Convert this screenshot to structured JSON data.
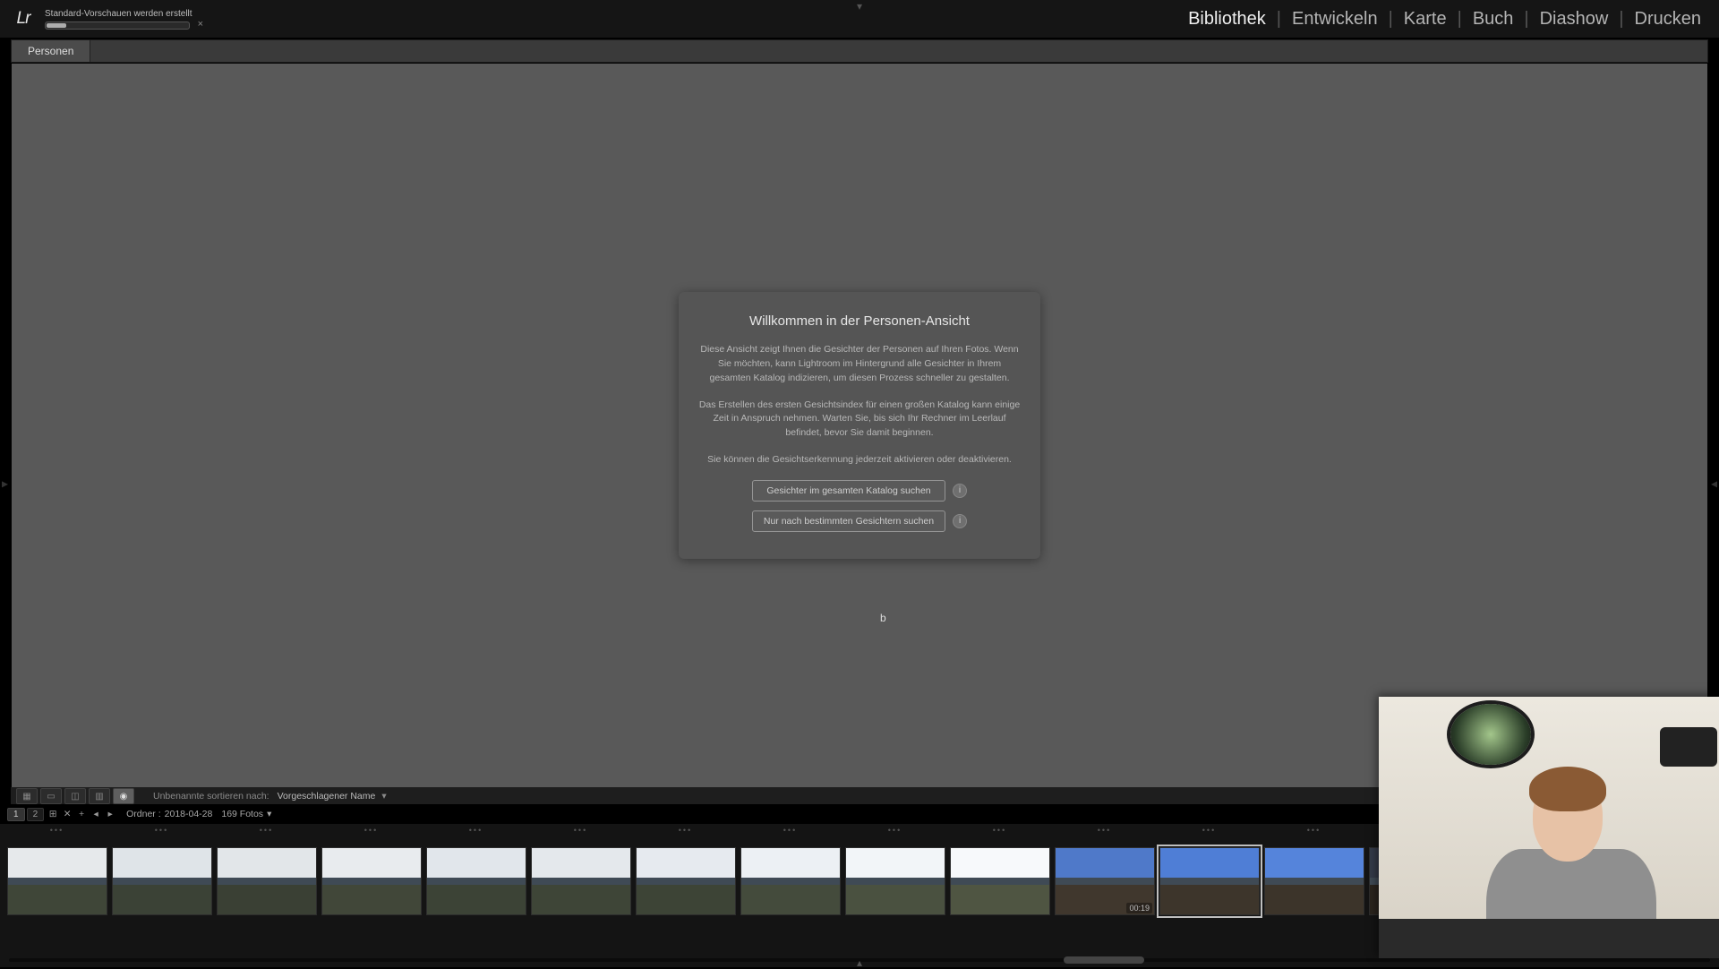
{
  "app": {
    "logo": "Lr"
  },
  "progress": {
    "label": "Standard-Vorschauen werden erstellt",
    "close": "×"
  },
  "modules": {
    "items": [
      "Bibliothek",
      "Entwickeln",
      "Karte",
      "Buch",
      "Diashow",
      "Drucken"
    ],
    "active_index": 0,
    "separator": "|"
  },
  "tabs": {
    "items": [
      "Personen"
    ]
  },
  "dialog": {
    "title": "Willkommen in der Personen-Ansicht",
    "p1": "Diese Ansicht zeigt Ihnen die Gesichter der Personen auf Ihren Fotos. Wenn Sie möchten, kann Lightroom im Hintergrund alle Gesichter in Ihrem gesamten Katalog indizieren, um diesen Prozess schneller zu gestalten.",
    "p2": "Das Erstellen des ersten Gesichtsindex für einen großen Katalog kann einige Zeit in Anspruch nehmen. Warten Sie, bis sich Ihr Rechner im Leerlauf befindet, bevor Sie damit beginnen.",
    "p3": "Sie können die Gesichtserkennung jederzeit aktivieren oder deaktivieren.",
    "btn1": "Gesichter im gesamten Katalog suchen",
    "btn2": "Nur nach bestimmten Gesichtern suchen",
    "info": "i"
  },
  "toolbar": {
    "sort_label": "Unbenannte sortieren nach:",
    "sort_value": "Vorgeschlagener Name"
  },
  "info_row": {
    "chip1": "1",
    "chip2": "2",
    "path_label": "Ordner :",
    "path_value": "2018-04-28",
    "count": "169 Fotos",
    "dd": "▾"
  },
  "filmstrip": {
    "thumbs": [
      {
        "sky": "#e6e9eb",
        "land": "#3f4638",
        "selected": false
      },
      {
        "sky": "#dfe4e8",
        "land": "#3b4236",
        "selected": false
      },
      {
        "sky": "#e2e6e9",
        "land": "#3a4034",
        "selected": false
      },
      {
        "sky": "#e8ebee",
        "land": "#414739",
        "selected": false
      },
      {
        "sky": "#e1e6eb",
        "land": "#3c4336",
        "selected": false
      },
      {
        "sky": "#e4e8ec",
        "land": "#3e4537",
        "selected": false
      },
      {
        "sky": "#e6eaef",
        "land": "#3d4436",
        "selected": false
      },
      {
        "sky": "#ecf0f4",
        "land": "#444b3c",
        "selected": false
      },
      {
        "sky": "#f2f5f8",
        "land": "#4a5140",
        "selected": false
      },
      {
        "sky": "#f7f9fb",
        "land": "#4f5542",
        "selected": false
      },
      {
        "sky": "#4f79c9",
        "land": "#40372d",
        "selected": false,
        "video": "00:19"
      },
      {
        "sky": "#4f7ed6",
        "land": "#3d352b",
        "selected": true
      },
      {
        "sky": "#5584db",
        "land": "#3c342a",
        "selected": false
      },
      {
        "sky": "#343b49",
        "land": "#2a241d",
        "selected": false
      },
      {
        "sky": "#30303a",
        "land": "#27221b",
        "selected": false
      },
      {
        "sky": "#2a2c34",
        "land": "#23201a",
        "selected": false
      },
      {
        "sky": "#20232d",
        "land": "#1e1b16",
        "selected": false
      }
    ]
  },
  "cursor_mark": "b",
  "glyphs": {
    "tri_down": "▾",
    "tri_up": "▴",
    "tri_left": "◂",
    "tri_right": "▸",
    "dots": "•••",
    "grid": "▦",
    "single": "▭",
    "compare": "◫",
    "survey": "▥",
    "people": "◉",
    "xy": "✕",
    "zoom": "⊞",
    "plus": "+",
    "left": "◂",
    "right": "▸"
  }
}
